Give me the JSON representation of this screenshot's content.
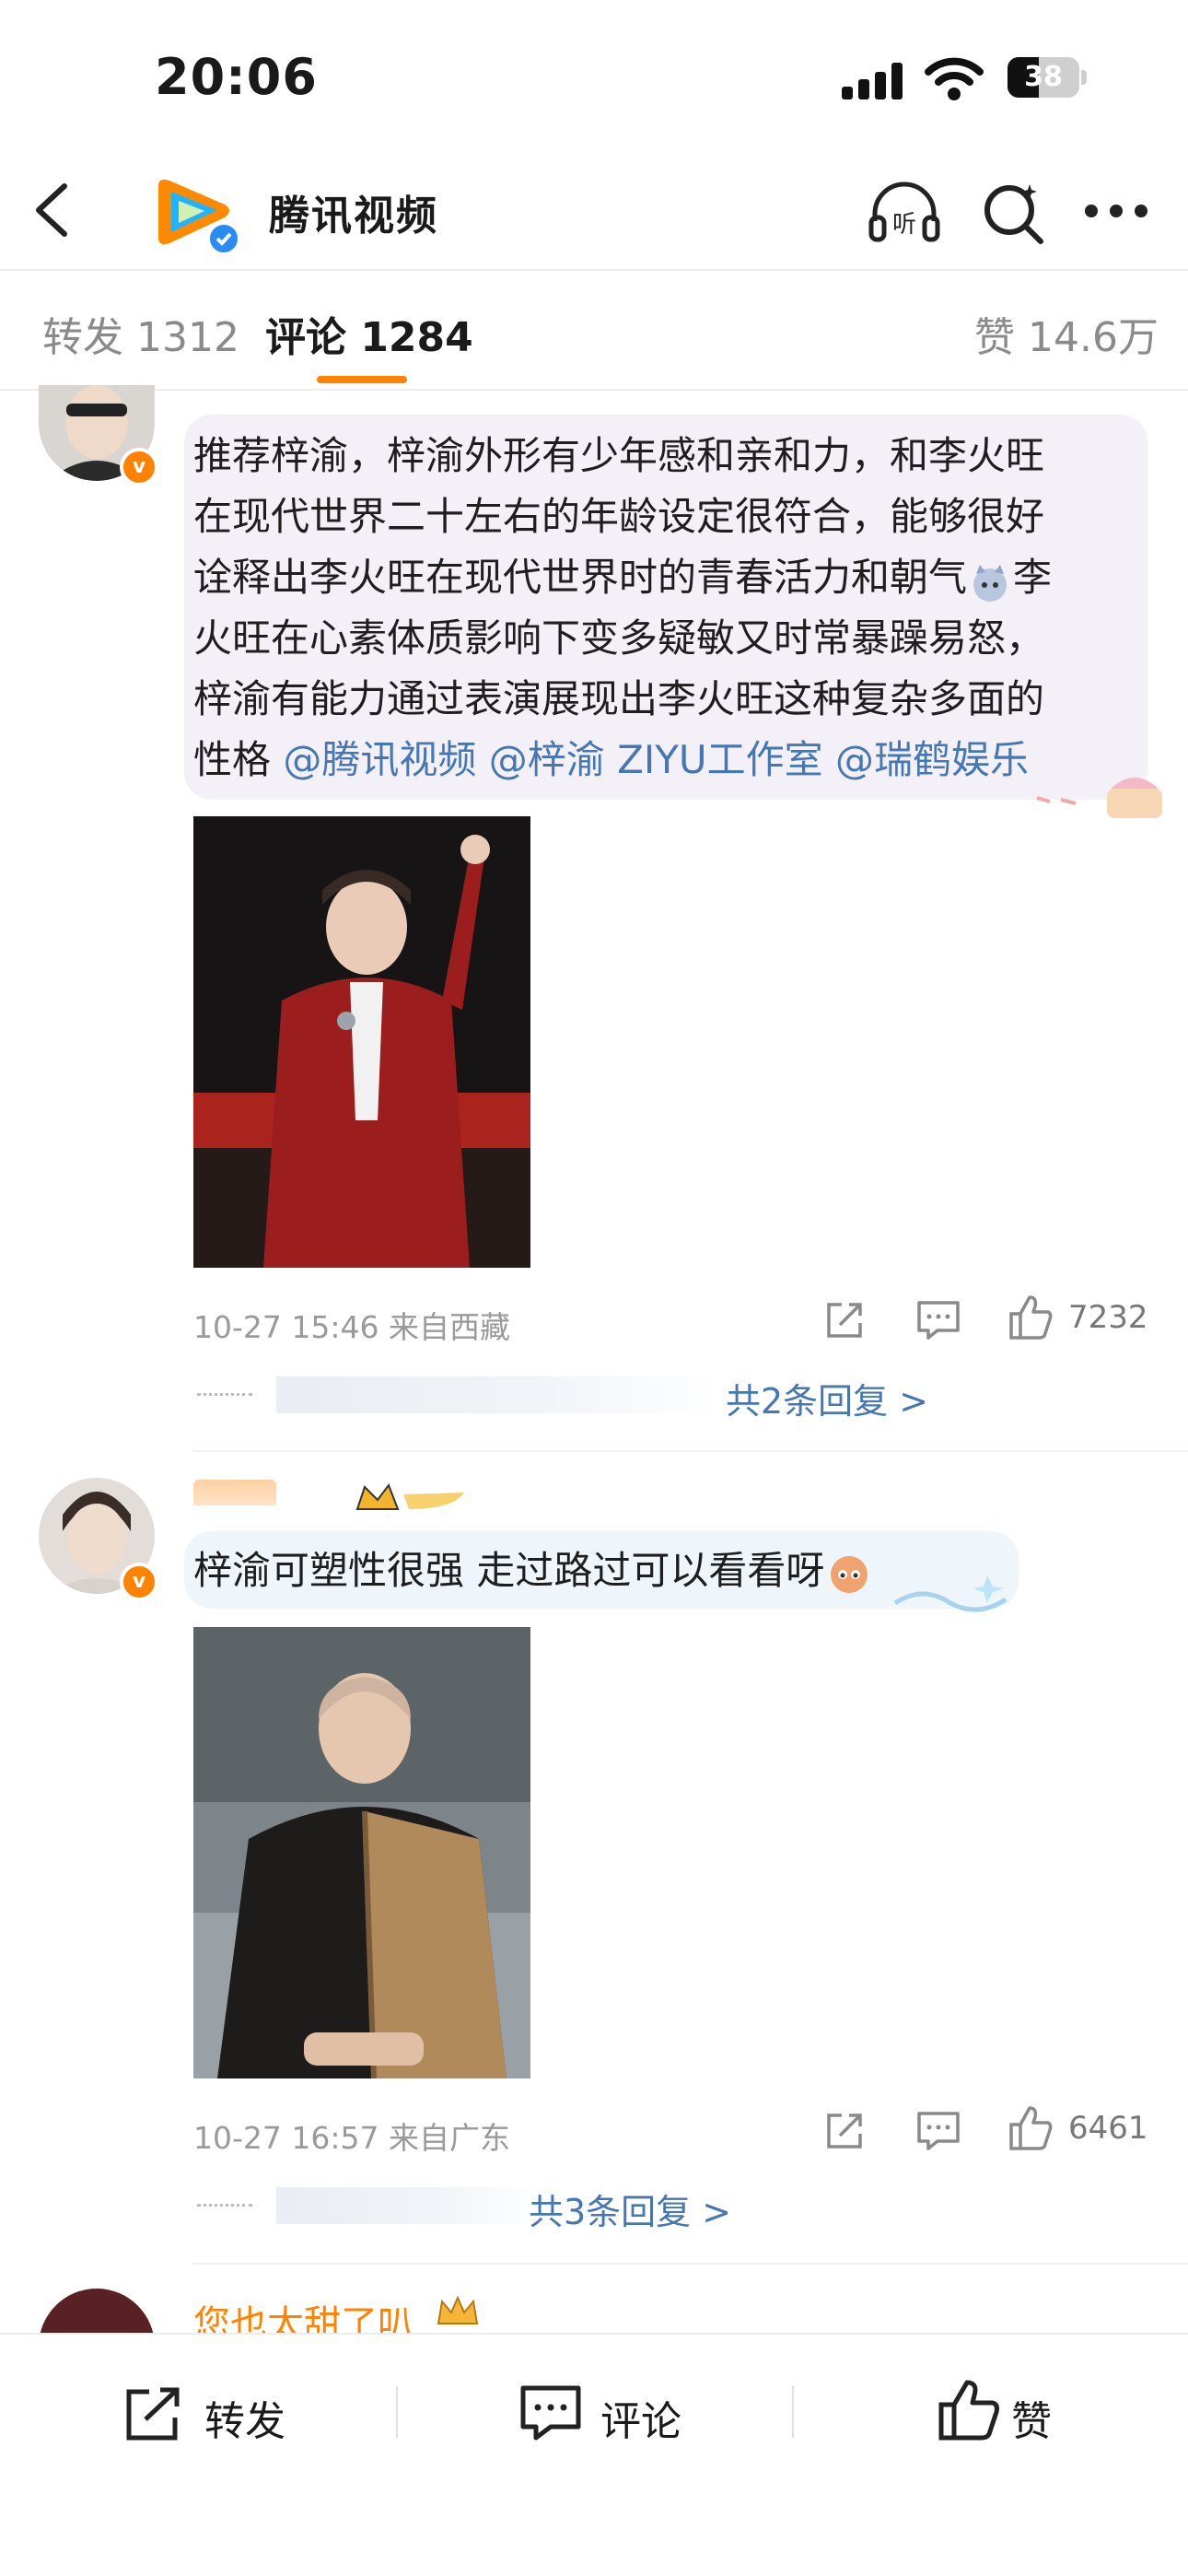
{
  "status": {
    "time": "20:06",
    "battery": "38"
  },
  "header": {
    "title": "腾讯视频"
  },
  "tabs": {
    "repost": "转发 1312",
    "comments": "评论 1284",
    "likes": "赞 14.6万"
  },
  "comments": [
    {
      "username": "",
      "text_lines": [
        "推荐梓渝，梓渝外形有少年感和亲和力，和李火旺",
        "在现代世界二十左右的年龄设定很符合，能够很好",
        "诠释出李火旺在现代世界时的青春活力和朝气",
        "火旺在心素体质影响下变多疑敏又时常暴躁易怒，",
        "梓渝有能力通过表演展现出李火旺这种复杂多面的"
      ],
      "line3_tail": "李",
      "last_line_prefix": "性格",
      "mentions": [
        "@腾讯视频",
        "@梓渝 ZIYU工作室",
        "@瑞鹤娱乐"
      ],
      "timestamp": "10-27 15:46 来自西藏",
      "likes": "7232",
      "replies": "共2条回复 >"
    },
    {
      "username": "",
      "text": "梓渝可塑性很强 走过路过可以看看呀",
      "timestamp": "10-27 16:57 来自广东",
      "likes": "6461",
      "replies": "共3条回复 >"
    },
    {
      "username": "您也太甜了叭"
    }
  ],
  "bottom_bar": {
    "repost": "转发",
    "comment": "评论",
    "like": "赞"
  },
  "colors": {
    "accent": "#ff8200",
    "mention": "#4677b3",
    "verified": "#2a8cf0"
  },
  "icons": [
    "back-icon",
    "tencent-video-logo",
    "listen-icon",
    "search-icon",
    "more-icon",
    "share-icon",
    "comment-icon",
    "like-icon"
  ]
}
